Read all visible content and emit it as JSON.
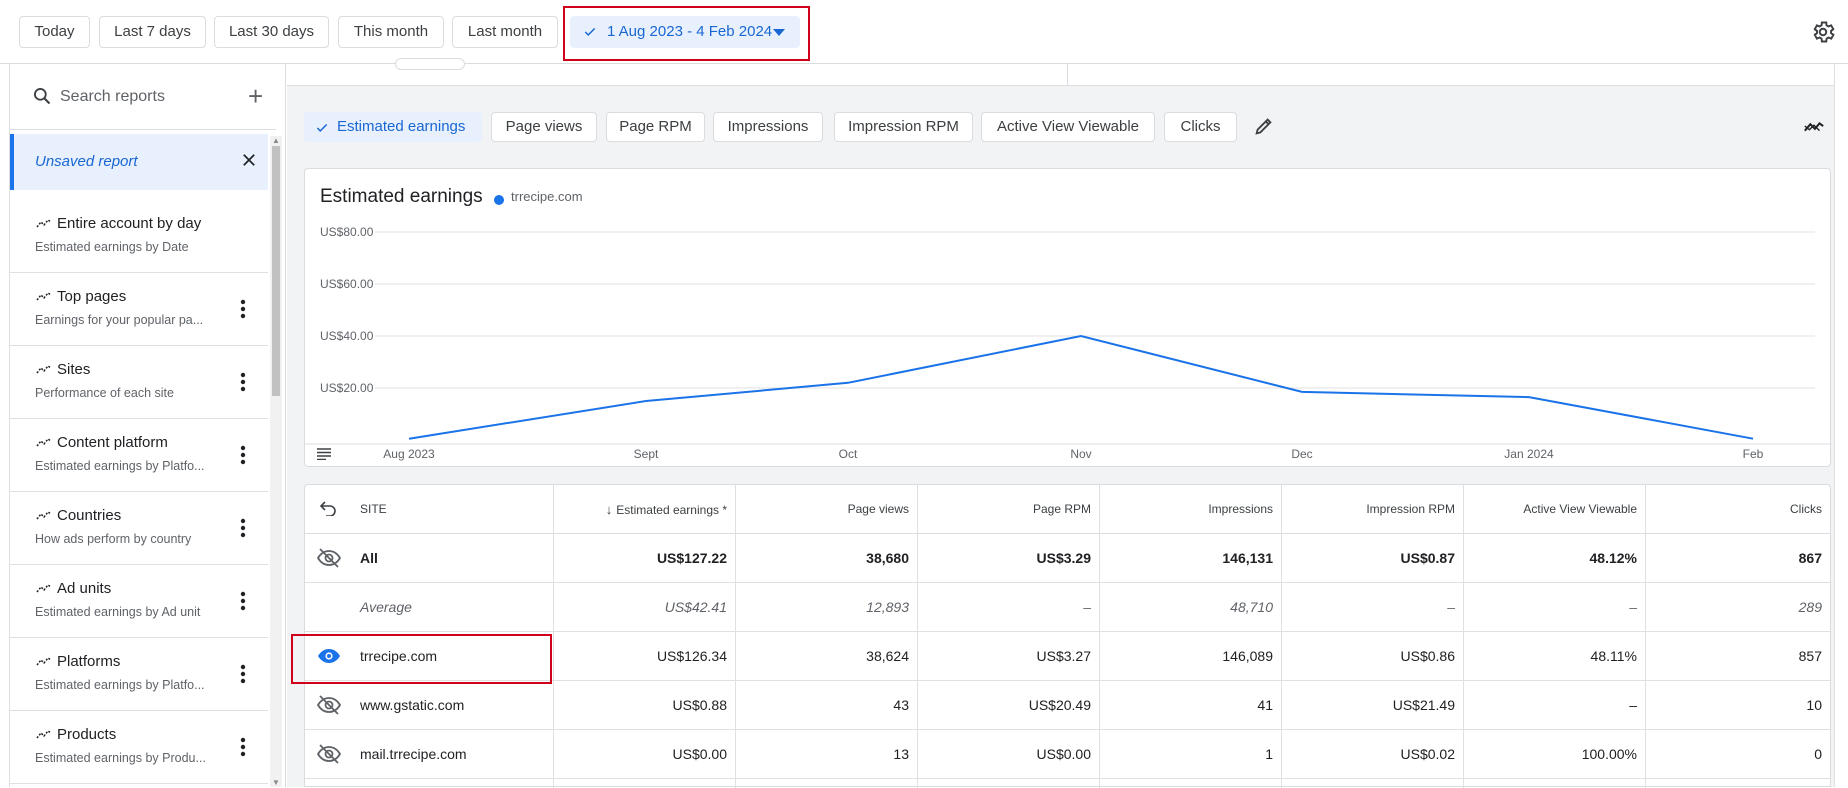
{
  "date_ranges": [
    "Today",
    "Last 7 days",
    "Last 30 days",
    "This month",
    "Last month"
  ],
  "selected_range": "1 Aug 2023 - 4 Feb 2024",
  "sidebar": {
    "search_placeholder": "Search reports",
    "unsaved_label": "Unsaved report",
    "reports": [
      {
        "name": "Entire account by day",
        "desc": "Estimated earnings by Date"
      },
      {
        "name": "Top pages",
        "desc": "Earnings for your popular pa..."
      },
      {
        "name": "Sites",
        "desc": "Performance of each site"
      },
      {
        "name": "Content platform",
        "desc": "Estimated earnings by Platfo..."
      },
      {
        "name": "Countries",
        "desc": "How ads perform by country"
      },
      {
        "name": "Ad units",
        "desc": "Estimated earnings by Ad unit"
      },
      {
        "name": "Platforms",
        "desc": "Estimated earnings by Platfo..."
      },
      {
        "name": "Products",
        "desc": "Estimated earnings by Produ..."
      }
    ]
  },
  "metrics": [
    "Estimated earnings",
    "Page views",
    "Page RPM",
    "Impressions",
    "Impression RPM",
    "Active View Viewable",
    "Clicks"
  ],
  "chart": {
    "title": "Estimated earnings",
    "legend": "trrecipe.com"
  },
  "chart_data": {
    "type": "line",
    "title": "Estimated earnings",
    "x": [
      "Aug 2023",
      "Sept",
      "Oct",
      "Nov",
      "Dec",
      "Jan 2024",
      "Feb"
    ],
    "y_ticks": [
      "US$80.00",
      "US$60.00",
      "US$40.00",
      "US$20.00"
    ],
    "ylim": [
      0,
      80
    ],
    "series": [
      {
        "name": "trrecipe.com",
        "values": [
          0.5,
          15,
          22,
          40,
          18.5,
          16.5,
          0.5
        ]
      }
    ],
    "color": "#1a73e8",
    "grid": true
  },
  "table": {
    "headers": [
      "SITE",
      "Estimated earnings *",
      "Page views",
      "Page RPM",
      "Impressions",
      "Impression RPM",
      "Active View Viewable",
      "Clicks"
    ],
    "rows": [
      {
        "site": "All",
        "values": [
          "US$127.22",
          "38,680",
          "US$3.29",
          "146,131",
          "US$0.87",
          "48.12%",
          "867"
        ]
      },
      {
        "site": "Average",
        "values": [
          "US$42.41",
          "12,893",
          "–",
          "48,710",
          "–",
          "–",
          "289"
        ]
      },
      {
        "site": "trrecipe.com",
        "values": [
          "US$126.34",
          "38,624",
          "US$3.27",
          "146,089",
          "US$0.86",
          "48.11%",
          "857"
        ]
      },
      {
        "site": "www.gstatic.com",
        "values": [
          "US$0.88",
          "43",
          "US$20.49",
          "41",
          "US$21.49",
          "–",
          "10"
        ]
      },
      {
        "site": "mail.trrecipe.com",
        "values": [
          "US$0.00",
          "13",
          "US$0.00",
          "1",
          "US$0.02",
          "100.00%",
          "0"
        ]
      }
    ]
  }
}
